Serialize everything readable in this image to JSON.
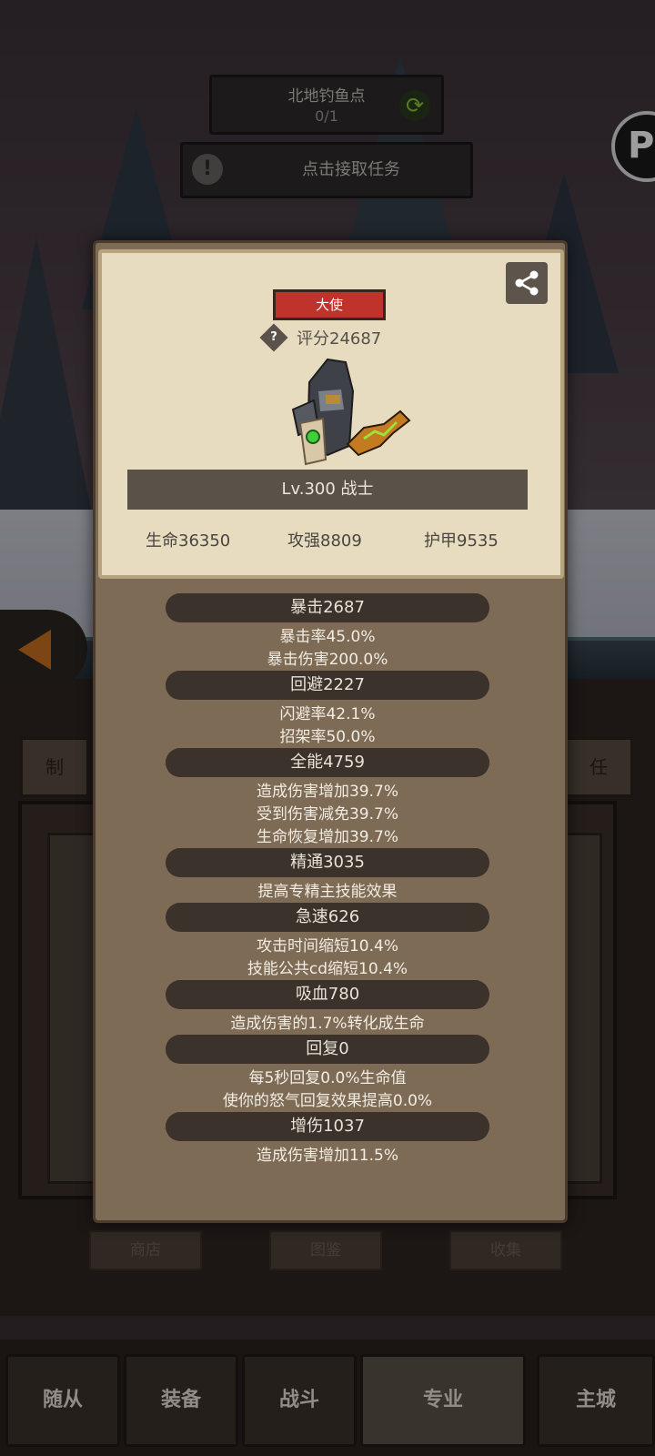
{
  "quest": {
    "title": "北地钓鱼点",
    "count": "0/1",
    "accept_label": "点击接取任务",
    "alert_glyph": "!"
  },
  "corner_button": {
    "glyph": "P"
  },
  "side_tabs": {
    "left": "制",
    "right": "任"
  },
  "character": {
    "rank": "大使",
    "score": "评分24687",
    "level_class": "Lv.300 战士",
    "hp": "生命36350",
    "attack": "攻强8809",
    "armor": "护甲9535"
  },
  "stats": [
    {
      "header": "暴击2687",
      "lines": [
        "暴击率45.0%",
        "暴击伤害200.0%"
      ]
    },
    {
      "header": "回避2227",
      "lines": [
        "闪避率42.1%",
        "招架率50.0%"
      ]
    },
    {
      "header": "全能4759",
      "lines": [
        "造成伤害增加39.7%",
        "受到伤害减免39.7%",
        "生命恢复增加39.7%"
      ]
    },
    {
      "header": "精通3035",
      "lines": [
        "提高专精主技能效果"
      ]
    },
    {
      "header": "急速626",
      "lines": [
        "攻击时间缩短10.4%",
        "技能公共cd缩短10.4%"
      ]
    },
    {
      "header": "吸血780",
      "lines": [
        "造成伤害的1.7%转化成生命"
      ]
    },
    {
      "header": "回复0",
      "lines": [
        "每5秒回复0.0%生命值",
        "使你的怒气回复效果提高0.0%"
      ]
    },
    {
      "header": "增伤1037",
      "lines": [
        "造成伤害增加11.5%"
      ]
    }
  ],
  "shop_row": [
    "商店",
    "图鉴",
    "收集"
  ],
  "bottom_nav": [
    "随从",
    "装备",
    "战斗",
    "专业",
    "主城"
  ],
  "colors": {
    "rank_red": "#c0322c",
    "card_bg": "#e8dcc0",
    "modal_bg": "#7d6b56"
  }
}
